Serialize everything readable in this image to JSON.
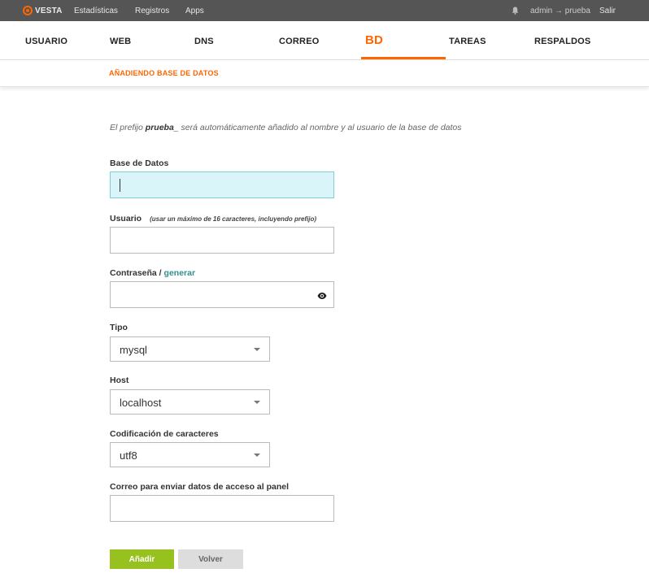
{
  "topbar": {
    "logo": "VESTA",
    "nav": [
      "Estadísticas",
      "Registros",
      "Apps"
    ],
    "user": "admin → prueba",
    "logout": "Salir"
  },
  "menu": {
    "items": [
      "USUARIO",
      "WEB",
      "DNS",
      "CORREO",
      "BD",
      "TAREAS",
      "RESPALDOS"
    ],
    "active": "BD"
  },
  "subbar": {
    "title": "AÑADIENDO BASE DE DATOS"
  },
  "form": {
    "note_pre": "El prefijo ",
    "note_prefix": "prueba_",
    "note_post": " será automáticamente añadido al nombre y al usuario de la base de datos",
    "database_label": "Base de Datos",
    "database_value": "",
    "user_label": "Usuario",
    "user_hint": "(usar un máximo de 16 caracteres, incluyendo prefijo)",
    "user_value": "",
    "password_label": "Contraseña / ",
    "password_generate": "generar",
    "password_value": "",
    "type_label": "Tipo",
    "type_value": "mysql",
    "host_label": "Host",
    "host_value": "localhost",
    "charset_label": "Codificación de caracteres",
    "charset_value": "utf8",
    "email_label": "Correo para enviar datos de acceso al panel",
    "email_value": ""
  },
  "buttons": {
    "add": "Añadir",
    "back": "Volver"
  },
  "colors": {
    "accent": "#ff6600",
    "topbar": "#555555",
    "add_button": "#96c11f",
    "focus_bg": "#d9f5f9",
    "link": "#2f8f8f"
  }
}
